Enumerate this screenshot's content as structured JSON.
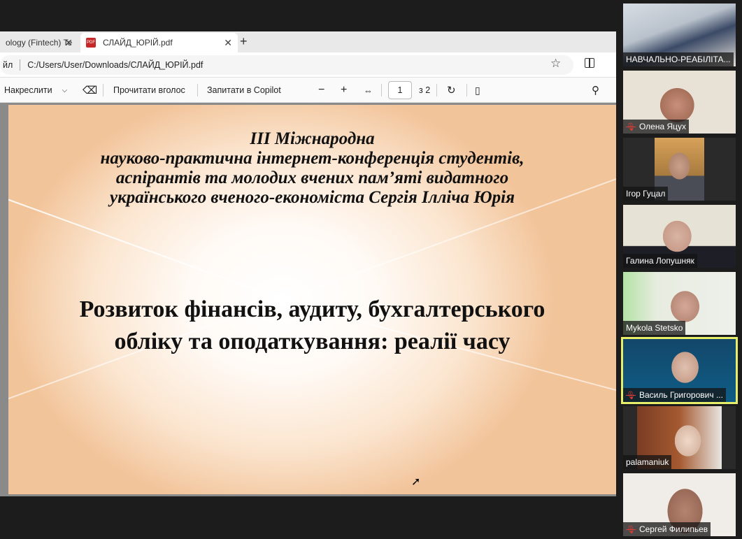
{
  "browser": {
    "tabs": [
      {
        "label": "ology (Fintech) Te",
        "active": false
      },
      {
        "label": "СЛАЙД_ЮРІЙ.pdf",
        "active": true
      }
    ],
    "pdf_icon": "PDF",
    "address_prefix": "йл",
    "address": "C:/Users/User/Downloads/СЛАЙД_ЮРІЙ.pdf"
  },
  "toolbar": {
    "draw": "Накреслити",
    "read_aloud": "Прочитати вголос",
    "ask_copilot": "Запитати в Copilot",
    "page": "1",
    "page_total": "з 2"
  },
  "slide": {
    "subtitle_lines": [
      "ІІІ Міжнародна",
      "науково-практична інтернет-конференція студентів,",
      "аспірантів та молодих вчених пам’яті видатного",
      "українського вченого-економіста Сергія Ілліча Юрія"
    ],
    "title_lines": [
      "Розвиток фінансів, аудиту, бухгалтерського",
      "обліку та оподаткування: реалії часу"
    ]
  },
  "participants": [
    {
      "name": "НАВЧАЛЬНО-РЕАБІЛІТА...",
      "muted": false
    },
    {
      "name": "Олена Яцух",
      "muted": true
    },
    {
      "name": "Ігор Гуцал",
      "muted": false
    },
    {
      "name": "Галина Лопушняк",
      "muted": false
    },
    {
      "name": "Mykola Stetsko",
      "muted": false
    },
    {
      "name": "Василь Григорович ...",
      "muted": true,
      "speaking": true
    },
    {
      "name": "palamaniuk",
      "muted": false
    },
    {
      "name": "Сергей Филипьев",
      "muted": true
    }
  ],
  "colors": {
    "speaker_highlight": "#e7ef6a",
    "muted_icon": "#e53935"
  }
}
